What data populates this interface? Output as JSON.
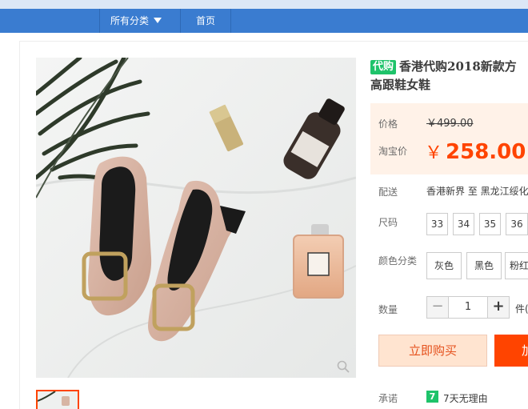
{
  "nav": {
    "category_label": "所有分类",
    "home_label": "首页"
  },
  "product": {
    "tag": "代购",
    "title_line1": "香港代购2018新款方",
    "title_line2": "高跟鞋女鞋"
  },
  "price": {
    "label": "价格",
    "original": "￥499.00",
    "promo_label": "淘宝价",
    "currency": "￥",
    "promo": "258.00"
  },
  "shipping": {
    "label": "配送",
    "text": "香港新界 至  黑龙江绥化"
  },
  "size": {
    "label": "尺码",
    "options": [
      "33",
      "34",
      "35",
      "36"
    ]
  },
  "color": {
    "label": "颜色分类",
    "options": [
      "灰色",
      "黑色",
      "粉红"
    ]
  },
  "quantity": {
    "label": "数量",
    "minus": "−",
    "value": "1",
    "plus": "+",
    "unit": "件(库"
  },
  "actions": {
    "buy_now": "立即购买",
    "add_cart": "加入购物车"
  },
  "promise": {
    "label": "承诺",
    "icon_glyph": "7",
    "text": "7天无理由"
  },
  "colors": {
    "nav_bar": "#3a7cd0",
    "accent": "#ff4400",
    "tag_green": "#1ec36a"
  }
}
